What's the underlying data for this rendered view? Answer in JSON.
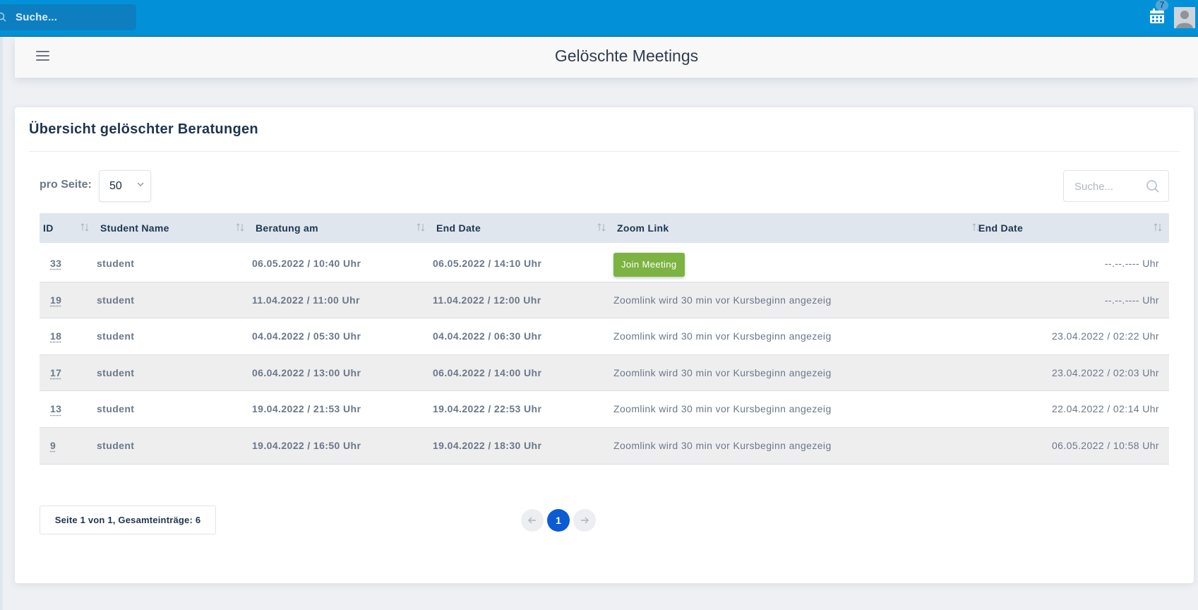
{
  "topbar": {
    "search_placeholder": "Suche...",
    "calendar_badge": "7",
    "brand_color": "#0291d8"
  },
  "page": {
    "title": "Gelöschte Meetings"
  },
  "card": {
    "title": "Übersicht gelöschter Beratungen",
    "per_page_label": "pro Seite:",
    "per_page_value": "50",
    "search_placeholder": "Suche..."
  },
  "table": {
    "headers": [
      "ID",
      "Student Name",
      "Beratung am",
      "End Date",
      "Zoom Link",
      "End Date"
    ],
    "rows": [
      {
        "id": "33",
        "student": "student",
        "beratung": "06.05.2022 / 10:40 Uhr",
        "end": "06.05.2022 / 14:10 Uhr",
        "zoom": "Join Meeting",
        "zoom_is_button": true,
        "end2": "--.--.---- Uhr"
      },
      {
        "id": "19",
        "student": "student",
        "beratung": "11.04.2022 / 11:00 Uhr",
        "end": "11.04.2022 / 12:00 Uhr",
        "zoom": "Zoomlink wird 30 min vor Kursbeginn angezeig",
        "zoom_is_button": false,
        "end2": "--.--.---- Uhr"
      },
      {
        "id": "18",
        "student": "student",
        "beratung": "04.04.2022 / 05:30 Uhr",
        "end": "04.04.2022 / 06:30 Uhr",
        "zoom": "Zoomlink wird 30 min vor Kursbeginn angezeig",
        "zoom_is_button": false,
        "end2": "23.04.2022 / 02:22 Uhr"
      },
      {
        "id": "17",
        "student": "student",
        "beratung": "06.04.2022 / 13:00 Uhr",
        "end": "06.04.2022 / 14:00 Uhr",
        "zoom": "Zoomlink wird 30 min vor Kursbeginn angezeig",
        "zoom_is_button": false,
        "end2": "23.04.2022 / 02:03 Uhr"
      },
      {
        "id": "13",
        "student": "student",
        "beratung": "19.04.2022 / 21:53 Uhr",
        "end": "19.04.2022 / 22:53 Uhr",
        "zoom": "Zoomlink wird 30 min vor Kursbeginn angezeig",
        "zoom_is_button": false,
        "end2": "22.04.2022 / 02:14 Uhr"
      },
      {
        "id": "9",
        "student": "student",
        "beratung": "19.04.2022 / 16:50 Uhr",
        "end": "19.04.2022 / 18:30 Uhr",
        "zoom": "Zoomlink wird 30 min vor Kursbeginn angezeig",
        "zoom_is_button": false,
        "end2": "06.05.2022 / 10:58 Uhr"
      }
    ]
  },
  "footer": {
    "page_info": "Seite 1 von 1, Gesamteinträge: 6",
    "current_page": "1"
  },
  "colors": {
    "join_button": "#7cb342",
    "active_page": "#0b5bd3",
    "header_row": "#dfe6ee"
  },
  "icons": [
    "search-icon",
    "calendar-icon",
    "user-avatar",
    "menu-icon",
    "chevron-down-icon",
    "sort-icon",
    "arrow-left-icon",
    "arrow-right-icon"
  ]
}
